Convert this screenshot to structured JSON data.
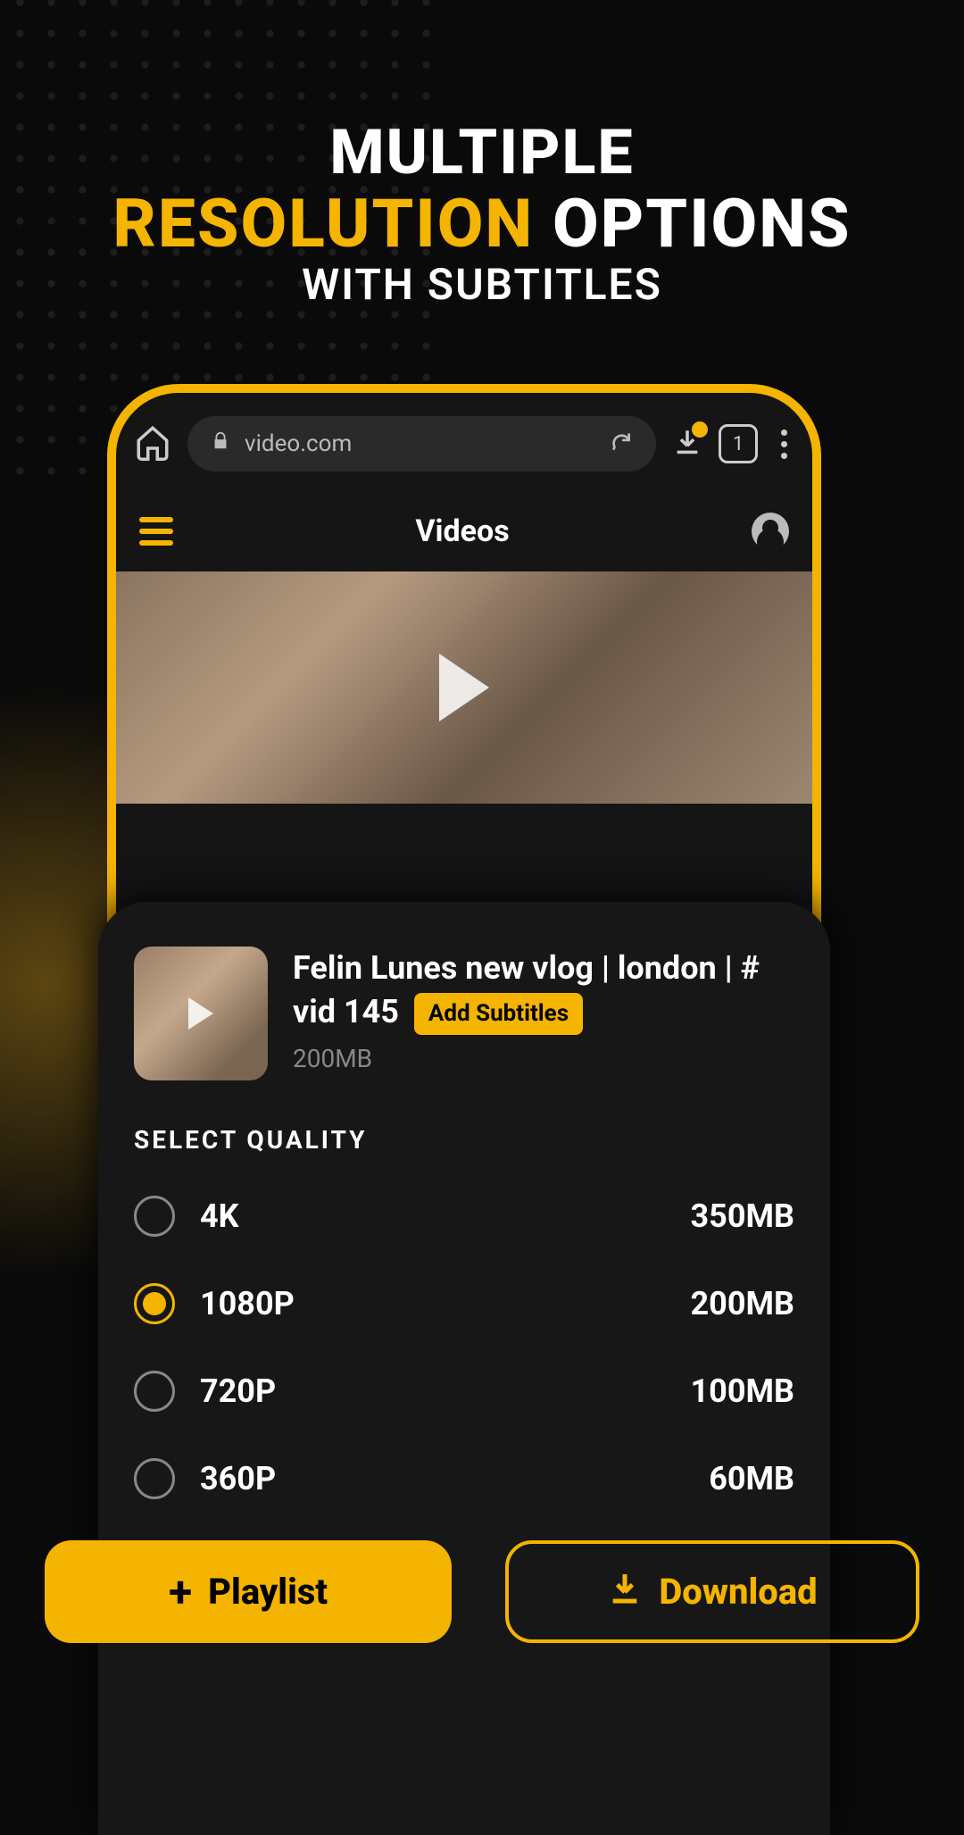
{
  "headline": {
    "line1": "MULTIPLE",
    "accent": "RESOLUTION",
    "options": "OPTIONS",
    "line3": "WITH SUBTITLES"
  },
  "browser": {
    "url": "video.com",
    "tab_count": "1"
  },
  "app": {
    "title": "Videos"
  },
  "video": {
    "title_part1": "Felin Lunes new vlog | london | # vid 145",
    "add_subtitles": "Add Subtitles",
    "size": "200MB"
  },
  "quality": {
    "section_label": "SELECT QUALITY",
    "options": [
      {
        "label": "4K",
        "size": "350MB",
        "selected": false
      },
      {
        "label": "1080P",
        "size": "200MB",
        "selected": true
      },
      {
        "label": "720P",
        "size": "100MB",
        "selected": false
      },
      {
        "label": "360P",
        "size": "60MB",
        "selected": false
      }
    ]
  },
  "buttons": {
    "playlist": "Playlist",
    "download": "Download"
  }
}
